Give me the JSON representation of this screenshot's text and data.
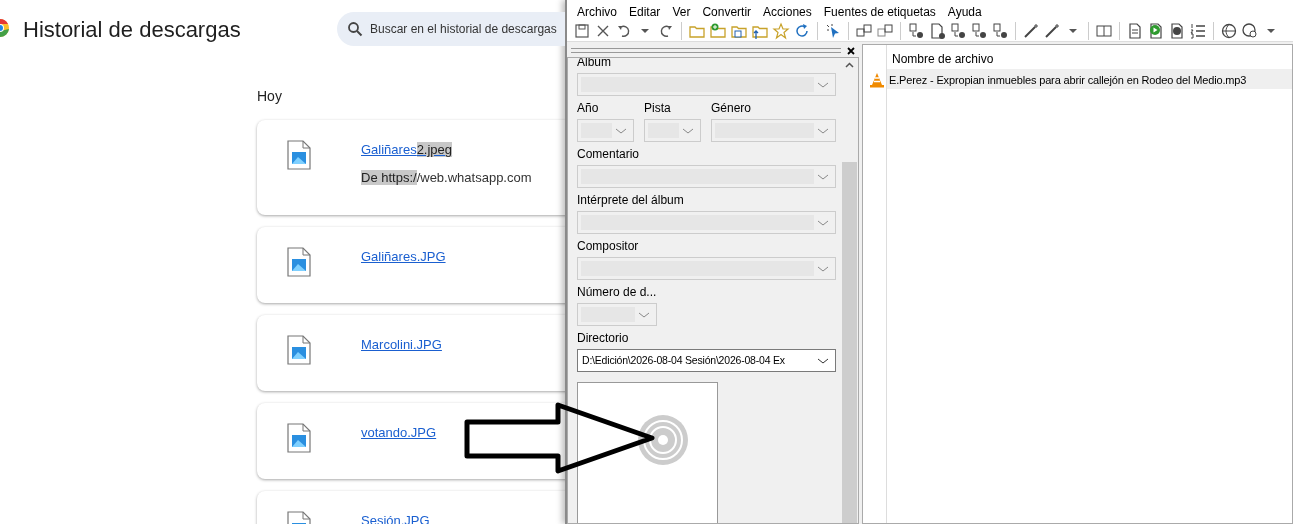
{
  "downloads_page": {
    "title": "Historial de descargas",
    "search": {
      "placeholder": "Buscar en el historial de descargas"
    },
    "section": "Hoy",
    "items": [
      {
        "name": [
          {
            "text": "Galiñares",
            "selected": false
          },
          {
            "text": "2.jpeg",
            "selected": true
          }
        ],
        "source": [
          {
            "text": "De https:/",
            "selected": true
          },
          {
            "text": "/web.whatsapp.com",
            "selected": false
          }
        ]
      },
      {
        "name": [
          {
            "text": "Galiñares.JPG",
            "selected": false
          }
        ]
      },
      {
        "name": [
          {
            "text": "Marcolini.JPG",
            "selected": false
          }
        ]
      },
      {
        "name": [
          {
            "text": "votando.JPG",
            "selected": false
          }
        ]
      },
      {
        "name": [
          {
            "text": "Sesión.JPG",
            "selected": false
          }
        ]
      }
    ]
  },
  "tag_editor": {
    "menu": [
      "Archivo",
      "Editar",
      "Ver",
      "Convertir",
      "Acciones",
      "Fuentes de etiquetas",
      "Ayuda"
    ],
    "field_rows": [
      [
        {
          "label": "Album",
          "kind": "full",
          "disabled": true
        }
      ],
      [
        {
          "label": "Año",
          "kind": "narrow",
          "disabled": true
        },
        {
          "label": "Pista",
          "kind": "narrow",
          "disabled": true
        },
        {
          "label": "Género",
          "kind": "wide",
          "disabled": true
        }
      ],
      [
        {
          "label": "Comentario",
          "kind": "full",
          "disabled": true
        }
      ],
      [
        {
          "label": "Intérprete del álbum",
          "kind": "full",
          "disabled": true
        }
      ],
      [
        {
          "label": "Compositor",
          "kind": "full",
          "disabled": true
        }
      ],
      [
        {
          "label": "Número de d...",
          "kind": "short",
          "disabled": true
        }
      ],
      [
        {
          "label": "Directorio",
          "kind": "full",
          "disabled": false,
          "value": "D:\\Edición\\2026-08-04 Sesión\\2026-08-04 Ex"
        }
      ]
    ],
    "file_list": {
      "column": "Nombre de archivo",
      "rows": [
        {
          "name": "E.Perez - Expropian inmuebles para abrir callejón en Rodeo del Medio.mp3",
          "selected": true
        }
      ]
    }
  }
}
